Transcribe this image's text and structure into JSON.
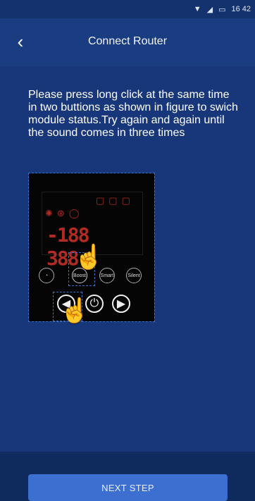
{
  "status_bar": {
    "wifi_icon": "wifi-icon",
    "signal_icon": "signal-icon",
    "battery_icon": "battery-icon",
    "time": "16 42"
  },
  "header": {
    "back_icon": "back-icon",
    "title": "Connect Router"
  },
  "instructions": "Please press long click at the same time in two buttions as shown in figure to swich module status.Try again and again until the sound comes in three times",
  "figure": {
    "lcd_digits_left": "-188",
    "lcd_digits_right": "388",
    "button_labels": {
      "boost": "Boost",
      "smart": "Smart",
      "silent": "Silent"
    },
    "icons": [
      "sun-icon",
      "fan-icon",
      "circle-icon",
      "power-icon",
      "left-arrow-icon",
      "right-arrow-icon",
      "hand-icon"
    ]
  },
  "next_button": {
    "label": "NEXT STEP"
  },
  "colors": {
    "background": "#17377a",
    "header": "#1a3d82",
    "button": "#3d6fd1",
    "lcd_segments": "#b12a24"
  }
}
